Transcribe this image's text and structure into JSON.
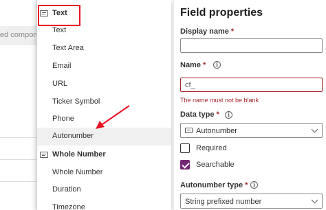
{
  "background": {
    "component_text": "ed compone"
  },
  "menu": {
    "items": [
      {
        "label": "Text",
        "header": true,
        "icon": "text-field-icon"
      },
      {
        "label": "Text"
      },
      {
        "label": "Text Area"
      },
      {
        "label": "Email"
      },
      {
        "label": "URL"
      },
      {
        "label": "Ticker Symbol"
      },
      {
        "label": "Phone"
      },
      {
        "label": "Autonumber",
        "highlighted": true
      },
      {
        "label": "Whole Number",
        "header": true,
        "icon": "number-field-icon"
      },
      {
        "label": "Whole Number"
      },
      {
        "label": "Duration"
      },
      {
        "label": "Timezone"
      }
    ]
  },
  "panel": {
    "title": "Field properties",
    "display_name": {
      "label": "Display name",
      "required_mark": "*",
      "value": ""
    },
    "name": {
      "label": "Name",
      "required_mark": "*",
      "value": "cf_",
      "error": "The name must not be blank"
    },
    "data_type": {
      "label": "Data type",
      "required_mark": "*",
      "value": "Autonumber"
    },
    "required": {
      "label": "Required",
      "checked": false
    },
    "searchable": {
      "label": "Searchable",
      "checked": true
    },
    "autonumber_type": {
      "label": "Autonumber type",
      "required_mark": "*",
      "value": "String prefixed number"
    }
  },
  "colors": {
    "highlight_box": "#e81123",
    "error": "#a4262c",
    "checkbox_accent": "#742774"
  }
}
